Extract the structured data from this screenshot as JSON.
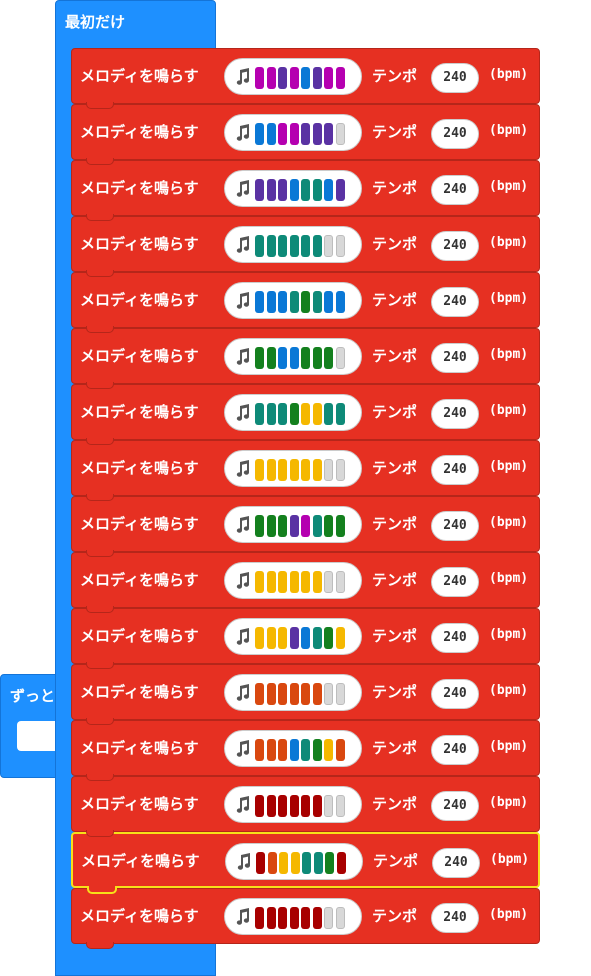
{
  "forever_block": {
    "label": "ずっと"
  },
  "onstart_block": {
    "label": "最初だけ"
  },
  "colors": {
    "block_red": "#e63022",
    "block_blue": "#1e90ff",
    "selected_outline": "#f7e01a",
    "notes": {
      "M": "#b500b0",
      "P": "#5a32a3",
      "B": "#0a78d6",
      "T": "#0e8a78",
      "G": "#14801e",
      "Y": "#f5b800",
      "O": "#d9480f",
      "R": "#a80000",
      "E": "#d8d8d8"
    }
  },
  "melody_blocks": [
    {
      "label": "メロディを鳴らす",
      "notes": [
        "M",
        "M",
        "P",
        "M",
        "B",
        "P",
        "M",
        "M"
      ],
      "tempo_label": "テンポ",
      "tempo": "240",
      "unit": "(bpm)",
      "selected": false
    },
    {
      "label": "メロディを鳴らす",
      "notes": [
        "B",
        "B",
        "M",
        "M",
        "P",
        "P",
        "P",
        "E"
      ],
      "tempo_label": "テンポ",
      "tempo": "240",
      "unit": "(bpm)",
      "selected": false
    },
    {
      "label": "メロディを鳴らす",
      "notes": [
        "P",
        "P",
        "P",
        "B",
        "T",
        "T",
        "B",
        "P"
      ],
      "tempo_label": "テンポ",
      "tempo": "240",
      "unit": "(bpm)",
      "selected": false
    },
    {
      "label": "メロディを鳴らす",
      "notes": [
        "T",
        "T",
        "T",
        "T",
        "T",
        "T",
        "E",
        "E"
      ],
      "tempo_label": "テンポ",
      "tempo": "240",
      "unit": "(bpm)",
      "selected": false
    },
    {
      "label": "メロディを鳴らす",
      "notes": [
        "B",
        "B",
        "B",
        "T",
        "G",
        "T",
        "B",
        "B"
      ],
      "tempo_label": "テンポ",
      "tempo": "240",
      "unit": "(bpm)",
      "selected": false
    },
    {
      "label": "メロディを鳴らす",
      "notes": [
        "G",
        "G",
        "B",
        "B",
        "G",
        "G",
        "G",
        "E"
      ],
      "tempo_label": "テンポ",
      "tempo": "240",
      "unit": "(bpm)",
      "selected": false
    },
    {
      "label": "メロディを鳴らす",
      "notes": [
        "T",
        "T",
        "T",
        "G",
        "Y",
        "Y",
        "T",
        "T"
      ],
      "tempo_label": "テンポ",
      "tempo": "240",
      "unit": "(bpm)",
      "selected": false
    },
    {
      "label": "メロディを鳴らす",
      "notes": [
        "Y",
        "Y",
        "Y",
        "Y",
        "Y",
        "Y",
        "E",
        "E"
      ],
      "tempo_label": "テンポ",
      "tempo": "240",
      "unit": "(bpm)",
      "selected": false
    },
    {
      "label": "メロディを鳴らす",
      "notes": [
        "G",
        "G",
        "G",
        "P",
        "M",
        "T",
        "G",
        "G"
      ],
      "tempo_label": "テンポ",
      "tempo": "240",
      "unit": "(bpm)",
      "selected": false
    },
    {
      "label": "メロディを鳴らす",
      "notes": [
        "Y",
        "Y",
        "Y",
        "Y",
        "Y",
        "Y",
        "E",
        "E"
      ],
      "tempo_label": "テンポ",
      "tempo": "240",
      "unit": "(bpm)",
      "selected": false
    },
    {
      "label": "メロディを鳴らす",
      "notes": [
        "Y",
        "Y",
        "Y",
        "P",
        "B",
        "T",
        "G",
        "Y"
      ],
      "tempo_label": "テンポ",
      "tempo": "240",
      "unit": "(bpm)",
      "selected": false
    },
    {
      "label": "メロディを鳴らす",
      "notes": [
        "O",
        "O",
        "O",
        "O",
        "O",
        "O",
        "E",
        "E"
      ],
      "tempo_label": "テンポ",
      "tempo": "240",
      "unit": "(bpm)",
      "selected": false
    },
    {
      "label": "メロディを鳴らす",
      "notes": [
        "O",
        "O",
        "O",
        "B",
        "T",
        "G",
        "Y",
        "O"
      ],
      "tempo_label": "テンポ",
      "tempo": "240",
      "unit": "(bpm)",
      "selected": false
    },
    {
      "label": "メロディを鳴らす",
      "notes": [
        "R",
        "R",
        "R",
        "R",
        "R",
        "R",
        "E",
        "E"
      ],
      "tempo_label": "テンポ",
      "tempo": "240",
      "unit": "(bpm)",
      "selected": false
    },
    {
      "label": "メロディを鳴らす",
      "notes": [
        "R",
        "O",
        "Y",
        "Y",
        "T",
        "T",
        "G",
        "R"
      ],
      "tempo_label": "テンポ",
      "tempo": "240",
      "unit": "(bpm)",
      "selected": true
    },
    {
      "label": "メロディを鳴らす",
      "notes": [
        "R",
        "R",
        "R",
        "R",
        "R",
        "R",
        "E",
        "E"
      ],
      "tempo_label": "テンポ",
      "tempo": "240",
      "unit": "(bpm)",
      "selected": false
    }
  ]
}
